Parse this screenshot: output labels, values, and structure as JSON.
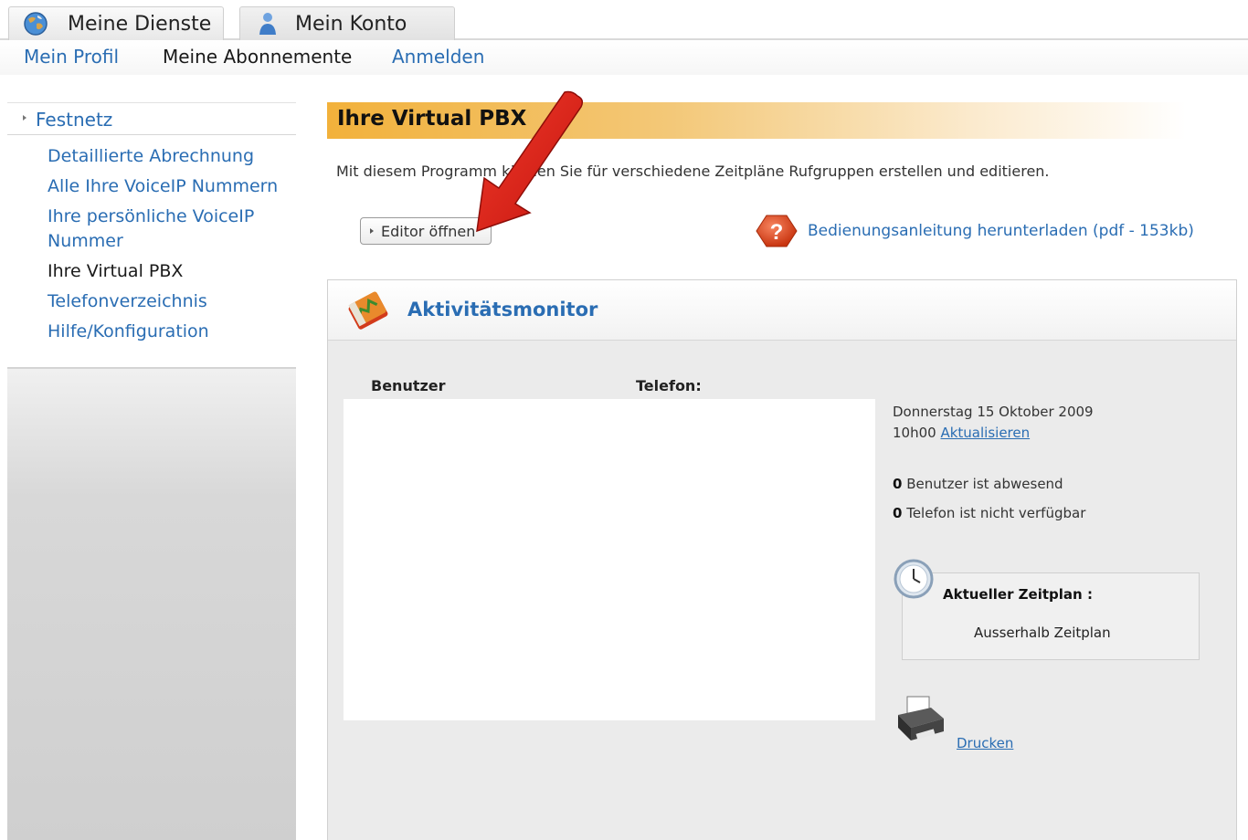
{
  "tabs": [
    {
      "label": "Meine Dienste",
      "icon": "globe-icon"
    },
    {
      "label": "Mein Konto",
      "icon": "user-icon"
    }
  ],
  "submenu": {
    "items": [
      "Mein Profil",
      "Meine Abonnemente",
      "Anmelden"
    ]
  },
  "sidebar": {
    "section": "Festnetz",
    "items": [
      {
        "label": "Detaillierte Abrechnung",
        "active": false
      },
      {
        "label": "Alle Ihre VoiceIP Nummern",
        "active": false
      },
      {
        "label": "Ihre persönliche VoiceIP Nummer",
        "active": false
      },
      {
        "label": "Ihre Virtual PBX",
        "active": true
      },
      {
        "label": "Telefonverzeichnis",
        "active": false
      },
      {
        "label": "Hilfe/Konfiguration",
        "active": false
      }
    ]
  },
  "main": {
    "title": "Ihre Virtual PBX",
    "intro": "Mit diesem Programm können Sie für verschiedene Zeitpläne Rufgruppen erstellen und editieren.",
    "editor_button": "Editor öffnen",
    "help_link": "Bedienungsanleitung herunterladen (pdf - 153kb)"
  },
  "monitor": {
    "title": "Aktivitätsmonitor",
    "col_user": "Benutzer",
    "col_phone": "Telefon:",
    "date": "Donnerstag 15 Oktober 2009",
    "time": "10h00",
    "refresh": "Aktualisieren",
    "absent_count": "0",
    "absent_text": "Benutzer ist abwesend",
    "unavailable_count": "0",
    "unavailable_text": "Telefon ist nicht verfügbar",
    "schedule_label": "Aktueller Zeitplan :",
    "schedule_value": "Ausserhalb Zeitplan",
    "print": "Drucken"
  },
  "colors": {
    "link": "#2a6db3",
    "title_bar": "#f2b13b",
    "annotation_arrow": "#e0201b"
  }
}
